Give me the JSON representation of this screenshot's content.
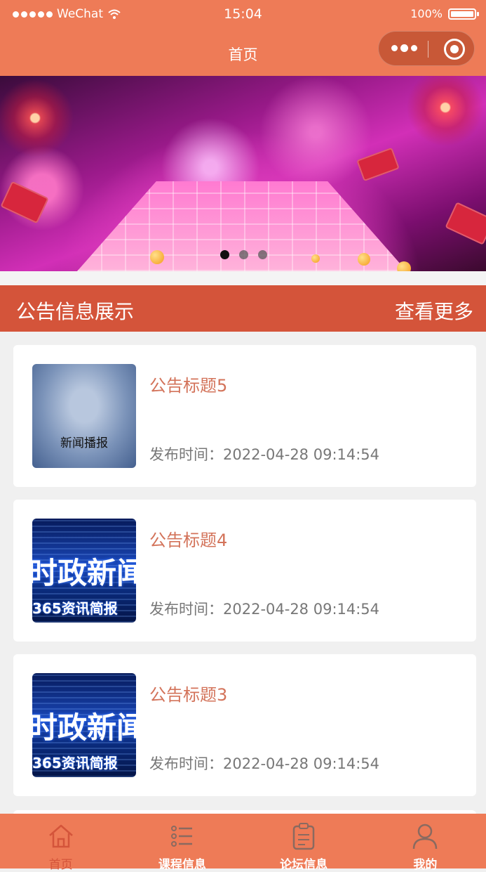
{
  "status_bar": {
    "carrier": "WeChat",
    "time": "15:04",
    "battery": "100%",
    "battery_level": 1.0
  },
  "nav": {
    "title": "首页"
  },
  "banner": {
    "slide_count": 3,
    "active_index": 0
  },
  "section": {
    "title": "公告信息展示",
    "more_label": "查看更多"
  },
  "notices": [
    {
      "title": "公告标题5",
      "time": "发布时间：2022-04-28 09:14:54",
      "thumb_caption": "新闻播报"
    },
    {
      "title": "公告标题4",
      "time": "发布时间：2022-04-28 09:14:54",
      "thumb_big": "时政新闻",
      "thumb_small": "365资讯简报"
    },
    {
      "title": "公告标题3",
      "time": "发布时间：2022-04-28 09:14:54",
      "thumb_big": "时政新闻",
      "thumb_small": "365资讯简报"
    }
  ],
  "tabs": [
    {
      "label": "首页",
      "icon": "home-icon",
      "active": true
    },
    {
      "label": "课程信息",
      "icon": "list-icon",
      "active": false
    },
    {
      "label": "论坛信息",
      "icon": "clipboard-icon",
      "active": false
    },
    {
      "label": "我的",
      "icon": "user-icon",
      "active": false
    }
  ],
  "colors": {
    "theme": "#ee7b57",
    "section_header": "#d4543a",
    "title_text": "#d3735a"
  }
}
